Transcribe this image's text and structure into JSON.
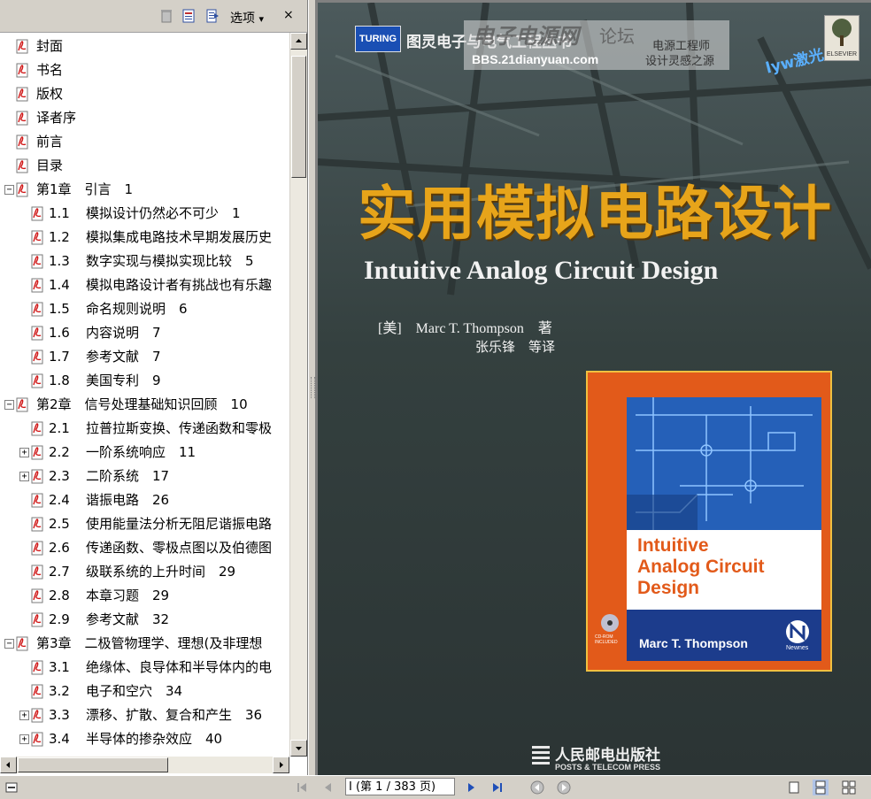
{
  "toolbar": {
    "options_label": "选项",
    "close_glyph": "×",
    "dropdown_glyph": "▾"
  },
  "bookmarks": [
    {
      "level": 0,
      "label": "封面",
      "num": ""
    },
    {
      "level": 0,
      "label": "书名",
      "num": ""
    },
    {
      "level": 0,
      "label": "版权",
      "num": ""
    },
    {
      "level": 0,
      "label": "译者序",
      "num": ""
    },
    {
      "level": 0,
      "label": "前言",
      "num": ""
    },
    {
      "level": 0,
      "label": "目录",
      "num": ""
    },
    {
      "level": 0,
      "label": "第1章　引言　1",
      "num": "",
      "expander": "−"
    },
    {
      "level": 1,
      "num": "1.1",
      "label": "模拟设计仍然必不可少　1"
    },
    {
      "level": 1,
      "num": "1.2",
      "label": "模拟集成电路技术早期发展历史"
    },
    {
      "level": 1,
      "num": "1.3",
      "label": "数字实现与模拟实现比较　5"
    },
    {
      "level": 1,
      "num": "1.4",
      "label": "模拟电路设计者有挑战也有乐趣"
    },
    {
      "level": 1,
      "num": "1.5",
      "label": "命名规则说明　6"
    },
    {
      "level": 1,
      "num": "1.6",
      "label": "内容说明　7"
    },
    {
      "level": 1,
      "num": "1.7",
      "label": "参考文献　7"
    },
    {
      "level": 1,
      "num": "1.8",
      "label": "美国专利　9"
    },
    {
      "level": 0,
      "label": "第2章　信号处理基础知识回顾　10",
      "num": "",
      "expander": "−"
    },
    {
      "level": 1,
      "num": "2.1",
      "label": "拉普拉斯变换、传递函数和零极"
    },
    {
      "level": 1,
      "num": "2.2",
      "label": "一阶系统响应　11",
      "expander": "+"
    },
    {
      "level": 1,
      "num": "2.3",
      "label": "二阶系统　17",
      "expander": "+"
    },
    {
      "level": 1,
      "num": "2.4",
      "label": "谐振电路　26"
    },
    {
      "level": 1,
      "num": "2.5",
      "label": "使用能量法分析无阻尼谐振电路"
    },
    {
      "level": 1,
      "num": "2.6",
      "label": "传递函数、零极点图以及伯德图"
    },
    {
      "level": 1,
      "num": "2.7",
      "label": "级联系统的上升时间　29"
    },
    {
      "level": 1,
      "num": "2.8",
      "label": "本章习题　29"
    },
    {
      "level": 1,
      "num": "2.9",
      "label": "参考文献　32"
    },
    {
      "level": 0,
      "label": "第3章　二极管物理学、理想(及非理想",
      "num": "",
      "expander": "−"
    },
    {
      "level": 1,
      "num": "3.1",
      "label": "绝缘体、良导体和半导体内的电"
    },
    {
      "level": 1,
      "num": "3.2",
      "label": "电子和空穴　34"
    },
    {
      "level": 1,
      "num": "3.3",
      "label": "漂移、扩散、复合和产生　36",
      "expander": "+"
    },
    {
      "level": 1,
      "num": "3.4",
      "label": "半导体的掺杂效应　40",
      "expander": "+"
    }
  ],
  "cover": {
    "series_logo": "TURING",
    "series_name": "图灵电子与电气工程丛书",
    "watermark_site": "电子电源网",
    "watermark_forum": "论坛",
    "watermark_url": "BBS.21dianyuan.com",
    "watermark_slogan1": "电源工程师",
    "watermark_slogan2": "设计灵感之源",
    "handwritten_tag": "lyw激光",
    "title_cn": "实用模拟电路设计",
    "title_en": "Intuitive Analog Circuit Design",
    "author_line": "[美]　Marc T. Thompson　著",
    "translator_line": "张乐锋　等译",
    "inner_title_1": "Intuitive",
    "inner_title_2": "Analog Circuit",
    "inner_title_3": "Design",
    "inner_author": "Marc T. Thompson",
    "inner_cd": "CD-ROM INCLUDED",
    "inner_publisher": "Newnes",
    "publisher_cn": "人民邮电出版社",
    "publisher_en": "POSTS & TELECOM PRESS",
    "elsevier": "ELSEVIER"
  },
  "status": {
    "page_display": "I (第 1 / 383 页)"
  }
}
